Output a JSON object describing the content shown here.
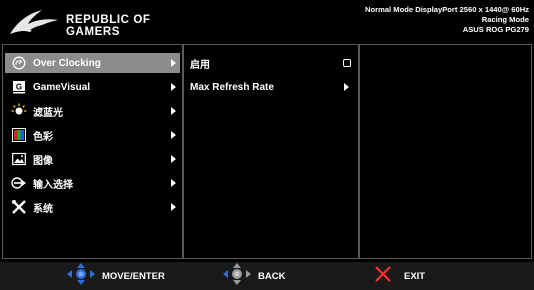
{
  "header": {
    "brand_line1": "REPUBLIC OF",
    "brand_line2": "GAMERS",
    "status_line1": "Normal Mode DisplayPort 2560 x 1440@ 60Hz",
    "status_line2": "Racing Mode",
    "status_line3": "ASUS ROG PG279"
  },
  "menu": {
    "items": [
      {
        "label": "Over Clocking",
        "icon": "overclock-icon",
        "selected": true
      },
      {
        "label": "GameVisual",
        "icon": "gamevisual-icon",
        "selected": false
      },
      {
        "label": "滤蓝光",
        "icon": "bluelight-filter-icon",
        "selected": false
      },
      {
        "label": "色彩",
        "icon": "color-icon",
        "selected": false
      },
      {
        "label": "图像",
        "icon": "image-icon",
        "selected": false
      },
      {
        "label": "输入选择",
        "icon": "input-select-icon",
        "selected": false
      },
      {
        "label": "系统",
        "icon": "system-tools-icon",
        "selected": false
      }
    ]
  },
  "submenu": {
    "items": [
      {
        "label": "启用",
        "control": "checkbox",
        "checked": false
      },
      {
        "label": "Max Refresh Rate",
        "control": "arrow"
      }
    ]
  },
  "footer": {
    "move_label": "MOVE/ENTER",
    "back_label": "BACK",
    "exit_label": "EXIT"
  },
  "colors": {
    "selected_bg": "#8c8c8c",
    "panel_border": "#5a5a5a",
    "joystick_blue": "#2b6fd6"
  }
}
